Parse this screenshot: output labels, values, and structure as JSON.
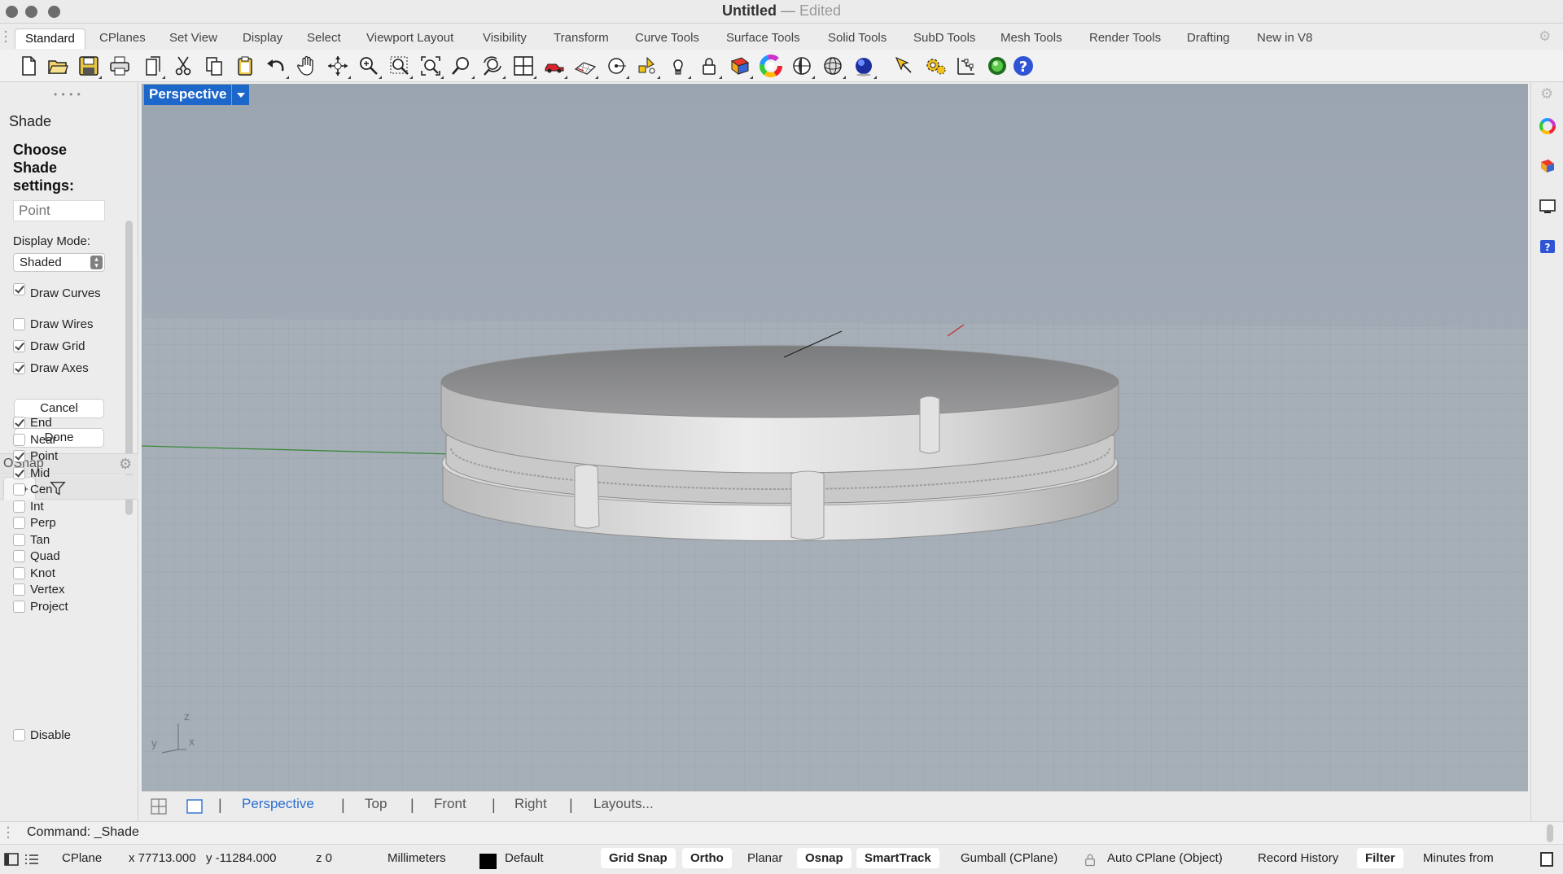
{
  "window": {
    "title": "Untitled",
    "separator": "—",
    "status": "Edited"
  },
  "tabs": [
    "Standard",
    "CPlanes",
    "Set View",
    "Display",
    "Select",
    "Viewport Layout",
    "Visibility",
    "Transform",
    "Curve Tools",
    "Surface Tools",
    "Solid Tools",
    "SubD Tools",
    "Mesh Tools",
    "Render Tools",
    "Drafting",
    "New in V8"
  ],
  "active_tab": "Standard",
  "toolbar_icons": [
    "new-file-icon",
    "open-folder-icon",
    "save-icon",
    "print-icon",
    "import-icon",
    "cut-icon",
    "copy-icon",
    "paste-icon",
    "undo-icon",
    "pan-hand-icon",
    "rotate-view-icon",
    "zoom-icon",
    "zoom-window-icon",
    "zoom-extents-icon",
    "zoom-selected-icon",
    "rotate-camera-icon",
    "four-viewports-icon",
    "car-render-icon",
    "grid-icon",
    "osnap-circle-icon",
    "object-snap-icon",
    "light-bulb-icon",
    "lock-icon",
    "layer-book-icon",
    "color-wheel-icon",
    "display-sphere-icon",
    "wire-sphere-icon",
    "render-sphere-icon",
    "pen-icon",
    "settings-gears-icon",
    "dimension-icon",
    "green-ball-icon",
    "help-icon"
  ],
  "shade_panel": {
    "title": "Shade",
    "prompt": "Choose Shade settings:",
    "point_placeholder": "Point",
    "display_mode_label": "Display Mode:",
    "display_mode_value": "Shaded",
    "options": [
      {
        "label": "Draw Curves",
        "checked": true
      },
      {
        "label": "Draw Wires",
        "checked": false
      },
      {
        "label": "Draw Grid",
        "checked": true
      },
      {
        "label": "Draw Axes",
        "checked": true
      }
    ],
    "cancel_label": "Cancel",
    "done_label": "Done"
  },
  "osnap": {
    "title": "OSnap",
    "items": [
      {
        "label": "End",
        "checked": true
      },
      {
        "label": "Near",
        "checked": false
      },
      {
        "label": "Point",
        "checked": true
      },
      {
        "label": "Mid",
        "checked": true
      },
      {
        "label": "Cen",
        "checked": false
      },
      {
        "label": "Int",
        "checked": false
      },
      {
        "label": "Perp",
        "checked": false
      },
      {
        "label": "Tan",
        "checked": false
      },
      {
        "label": "Quad",
        "checked": false
      },
      {
        "label": "Knot",
        "checked": false
      },
      {
        "label": "Vertex",
        "checked": false
      },
      {
        "label": "Project",
        "checked": false
      }
    ],
    "disable_label": "Disable",
    "disable_checked": false
  },
  "viewport": {
    "label": "Perspective",
    "axis_labels": {
      "z": "z",
      "y": "y",
      "x": "x"
    }
  },
  "viewport_tabs": [
    "Perspective",
    "Top",
    "Front",
    "Right",
    "Layouts..."
  ],
  "active_viewport_tab": "Perspective",
  "command": "Command: _Shade",
  "status": {
    "cplane": "CPlane",
    "x": "x 77713.000",
    "y": "y -11284.000",
    "z": "z 0",
    "units": "Millimeters",
    "layer": "Default",
    "layer_color": "#000000",
    "grid_snap": "Grid Snap",
    "ortho": "Ortho",
    "planar": "Planar",
    "osnap": "Osnap",
    "smarttrack": "SmartTrack",
    "gumball": "Gumball (CPlane)",
    "auto_cplane": "Auto CPlane (Object)",
    "record_history": "Record History",
    "filter": "Filter",
    "minutes": "Minutes from"
  },
  "colors": {
    "accent": "#1c67c9",
    "viewport_bg": "#a0a9b3",
    "object": "#d4d4d4"
  }
}
